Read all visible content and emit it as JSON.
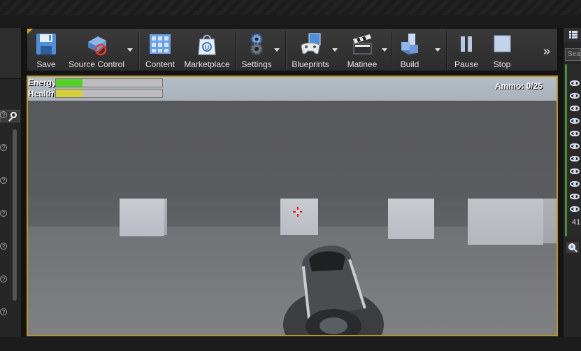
{
  "toolbar": {
    "buttons": [
      {
        "label": "Save",
        "icon": "floppy-disk-icon"
      },
      {
        "label": "Source Control",
        "icon": "source-control-icon"
      },
      {
        "label": "Content",
        "icon": "content-grid-icon"
      },
      {
        "label": "Marketplace",
        "icon": "marketplace-bag-icon"
      },
      {
        "label": "Settings",
        "icon": "gears-icon"
      },
      {
        "label": "Blueprints",
        "icon": "gamepad-icon"
      },
      {
        "label": "Matinee",
        "icon": "clapperboard-icon"
      },
      {
        "label": "Build",
        "icon": "build-blocks-icon"
      },
      {
        "label": "Pause",
        "icon": "pause-icon"
      },
      {
        "label": "Stop",
        "icon": "stop-icon"
      }
    ]
  },
  "hud": {
    "energy_label": "Energy",
    "health_label": "Health",
    "energy_level": 0.25,
    "health_level": 0.25,
    "energy_color": "#56d12a",
    "health_color": "#d4cd3c",
    "ammo": "Ammo: 0/25"
  },
  "right_panel": {
    "search_placeholder": "Sea",
    "count": "41"
  },
  "colors": {
    "accent": "#b8962a",
    "crosshair": "#e11111"
  }
}
